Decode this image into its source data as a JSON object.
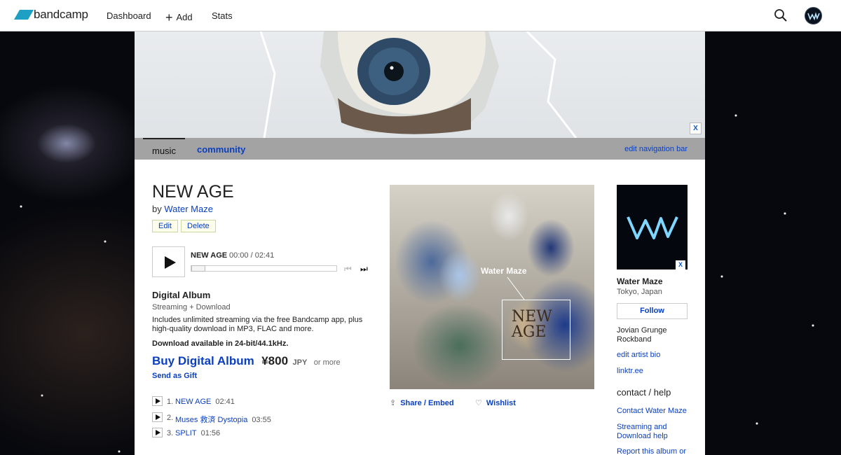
{
  "topbar": {
    "logo_text": "bandcamp",
    "nav": {
      "dashboard": "Dashboard",
      "add": "Add",
      "stats": "Stats"
    },
    "add_plus": "+"
  },
  "header": {
    "close_label": "X"
  },
  "tabs": {
    "music": "music",
    "community": "community",
    "edit_nav": "edit navigation bar"
  },
  "album": {
    "title": "NEW AGE",
    "by_prefix": "by",
    "artist": "Water Maze",
    "edit_label": "Edit",
    "delete_label": "Delete"
  },
  "player": {
    "track": "NEW AGE",
    "time": "00:00 / 02:41",
    "progress": 0
  },
  "digital": {
    "title": "Digital Album",
    "subtitle": "Streaming + Download",
    "description": "Includes unlimited streaming via the free Bandcamp app, plus high-quality download in MP3, FLAC and more.",
    "availability": "Download available in 24-bit/44.1kHz.",
    "buy_label": "Buy Digital Album",
    "price": "¥800",
    "currency": "JPY",
    "or_more": "or more",
    "gift_label": "Send as Gift"
  },
  "tracks": [
    {
      "num": "1.",
      "title": "NEW AGE",
      "duration": "02:41"
    },
    {
      "num": "2.",
      "title": "Muses 救済 Dystopia",
      "duration": "03:55"
    },
    {
      "num": "3.",
      "title": "SPLIT",
      "duration": "01:56"
    }
  ],
  "art": {
    "overlay_label": "Water Maze",
    "sign_line1": "NEW",
    "sign_line2": "AGE"
  },
  "actions": {
    "share": "Share / Embed",
    "wishlist": "Wishlist"
  },
  "band": {
    "name": "Water Maze",
    "location": "Tokyo, Japan",
    "follow": "Follow",
    "description": "Jovian Grunge Rockband",
    "edit_bio": "edit artist bio",
    "link": "linktr.ee",
    "close_label": "X"
  },
  "contact": {
    "heading": "contact / help",
    "contact_link": "Contact Water Maze",
    "streaming_help": "Streaming and Download help",
    "report": "Report this album or"
  },
  "colors": {
    "link": "#0a3fc0",
    "logo": "#1da0c3"
  }
}
